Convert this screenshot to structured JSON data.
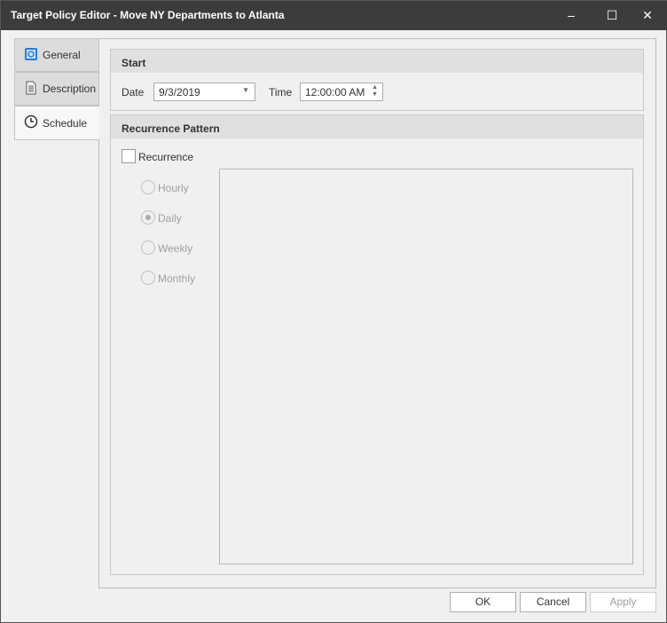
{
  "window": {
    "title": "Target Policy Editor - Move NY Departments to Atlanta",
    "minimize": "–",
    "maximize": "☐",
    "close": "✕"
  },
  "tabs": [
    {
      "label": "General",
      "icon": "safe-icon"
    },
    {
      "label": "Description",
      "icon": "document-icon"
    },
    {
      "label": "Schedule",
      "icon": "clock-icon",
      "selected": true
    }
  ],
  "start": {
    "header": "Start",
    "date_label": "Date",
    "date_value": "9/3/2019",
    "time_label": "Time",
    "time_value": "12:00:00 AM"
  },
  "recurrence": {
    "header": "Recurrence Pattern",
    "checkbox_label": "Recurrence",
    "checked": false,
    "options": [
      "Hourly",
      "Daily",
      "Weekly",
      "Monthly"
    ],
    "selected": "Daily"
  },
  "buttons": {
    "ok": "OK",
    "cancel": "Cancel",
    "apply": "Apply"
  }
}
